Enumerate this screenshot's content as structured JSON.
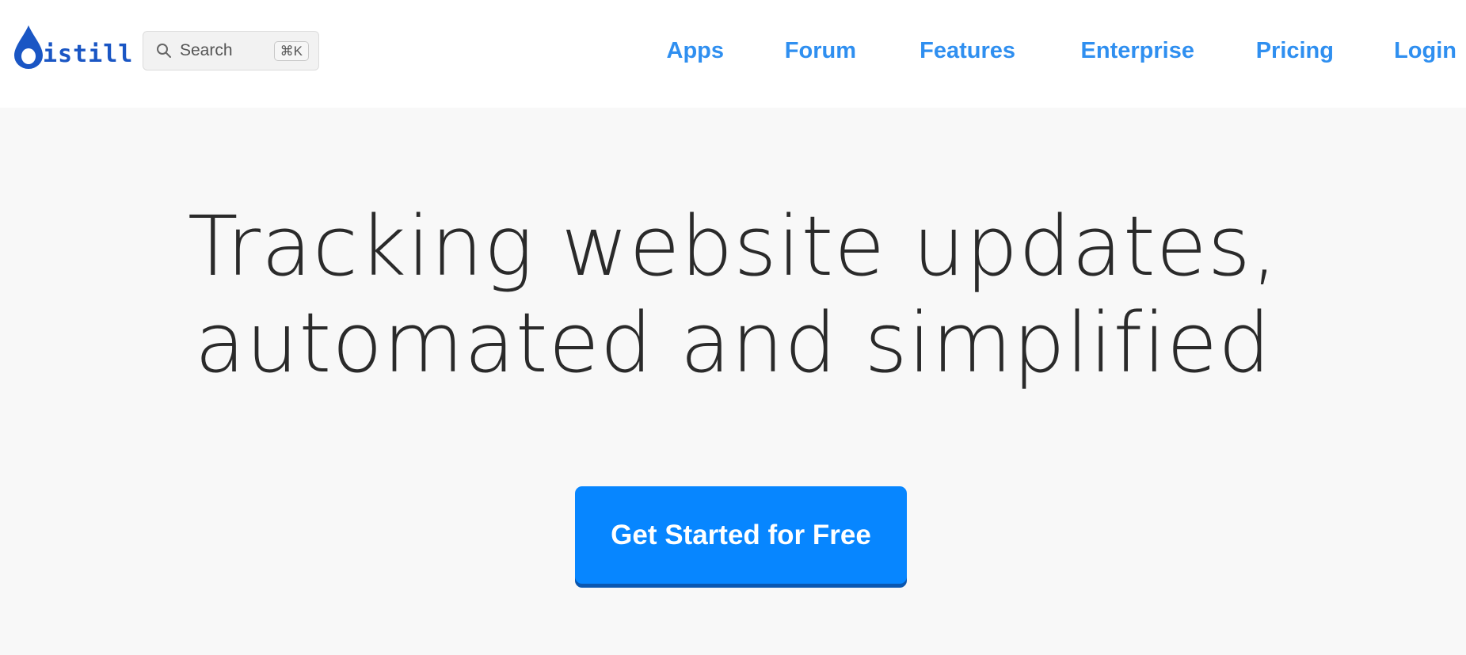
{
  "header": {
    "logo_text": "istill",
    "search": {
      "label": "Search",
      "shortcut": "⌘K"
    },
    "nav": [
      {
        "label": "Apps"
      },
      {
        "label": "Forum"
      },
      {
        "label": "Features"
      },
      {
        "label": "Enterprise"
      },
      {
        "label": "Pricing"
      },
      {
        "label": "Login"
      }
    ]
  },
  "hero": {
    "title_line1": "Tracking website updates,",
    "title_line2": "automated and simplified",
    "cta_label": "Get Started for Free"
  },
  "colors": {
    "brand": "#1a56c4",
    "nav_link": "#2f8ff0",
    "cta_bg": "#0786ff",
    "cta_shadow": "#0a57b0",
    "page_bg": "#f8f8f8",
    "header_bg": "#ffffff",
    "title_text": "#2a2a2a"
  },
  "icons": [
    "drop-logo-icon",
    "search-icon"
  ]
}
